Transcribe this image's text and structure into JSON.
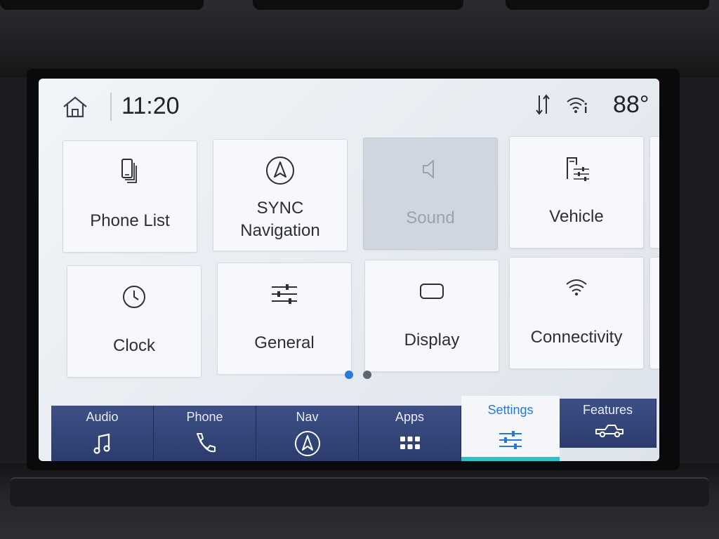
{
  "status": {
    "time": "11:20",
    "temperature": "88°",
    "home_icon": "home-icon",
    "sync_icon": "data-transfer-icon",
    "wifi_icon": "wifi-info-icon"
  },
  "tiles": [
    {
      "label": "Phone List",
      "icon": "phone-list-icon"
    },
    {
      "label": "SYNC\nNavigation",
      "line1": "SYNC",
      "line2": "Navigation",
      "icon": "navigation-icon"
    },
    {
      "label": "Sound",
      "icon": "speaker-icon",
      "disabled": true
    },
    {
      "label": "Vehicle",
      "icon": "vehicle-settings-icon"
    },
    {
      "label": "Clock",
      "icon": "clock-icon"
    },
    {
      "label": "General",
      "icon": "sliders-icon"
    },
    {
      "label": "Display",
      "icon": "display-icon"
    },
    {
      "label": "Connectivity",
      "icon": "wifi-icon"
    }
  ],
  "pagination": {
    "current": 1,
    "total": 2
  },
  "nav": [
    {
      "label": "Audio",
      "icon": "music-note-icon"
    },
    {
      "label": "Phone",
      "icon": "phone-handset-icon"
    },
    {
      "label": "Nav",
      "icon": "navigation-arrow-icon"
    },
    {
      "label": "Apps",
      "icon": "apps-grid-icon"
    },
    {
      "label": "Settings",
      "icon": "settings-sliders-icon",
      "active": true
    },
    {
      "label": "Features",
      "icon": "truck-icon"
    }
  ],
  "colors": {
    "accent": "#2b78d4",
    "nav_bg": "#33457a",
    "active_underline": "#27c3c9",
    "screen_bg": "#eef1f5"
  }
}
